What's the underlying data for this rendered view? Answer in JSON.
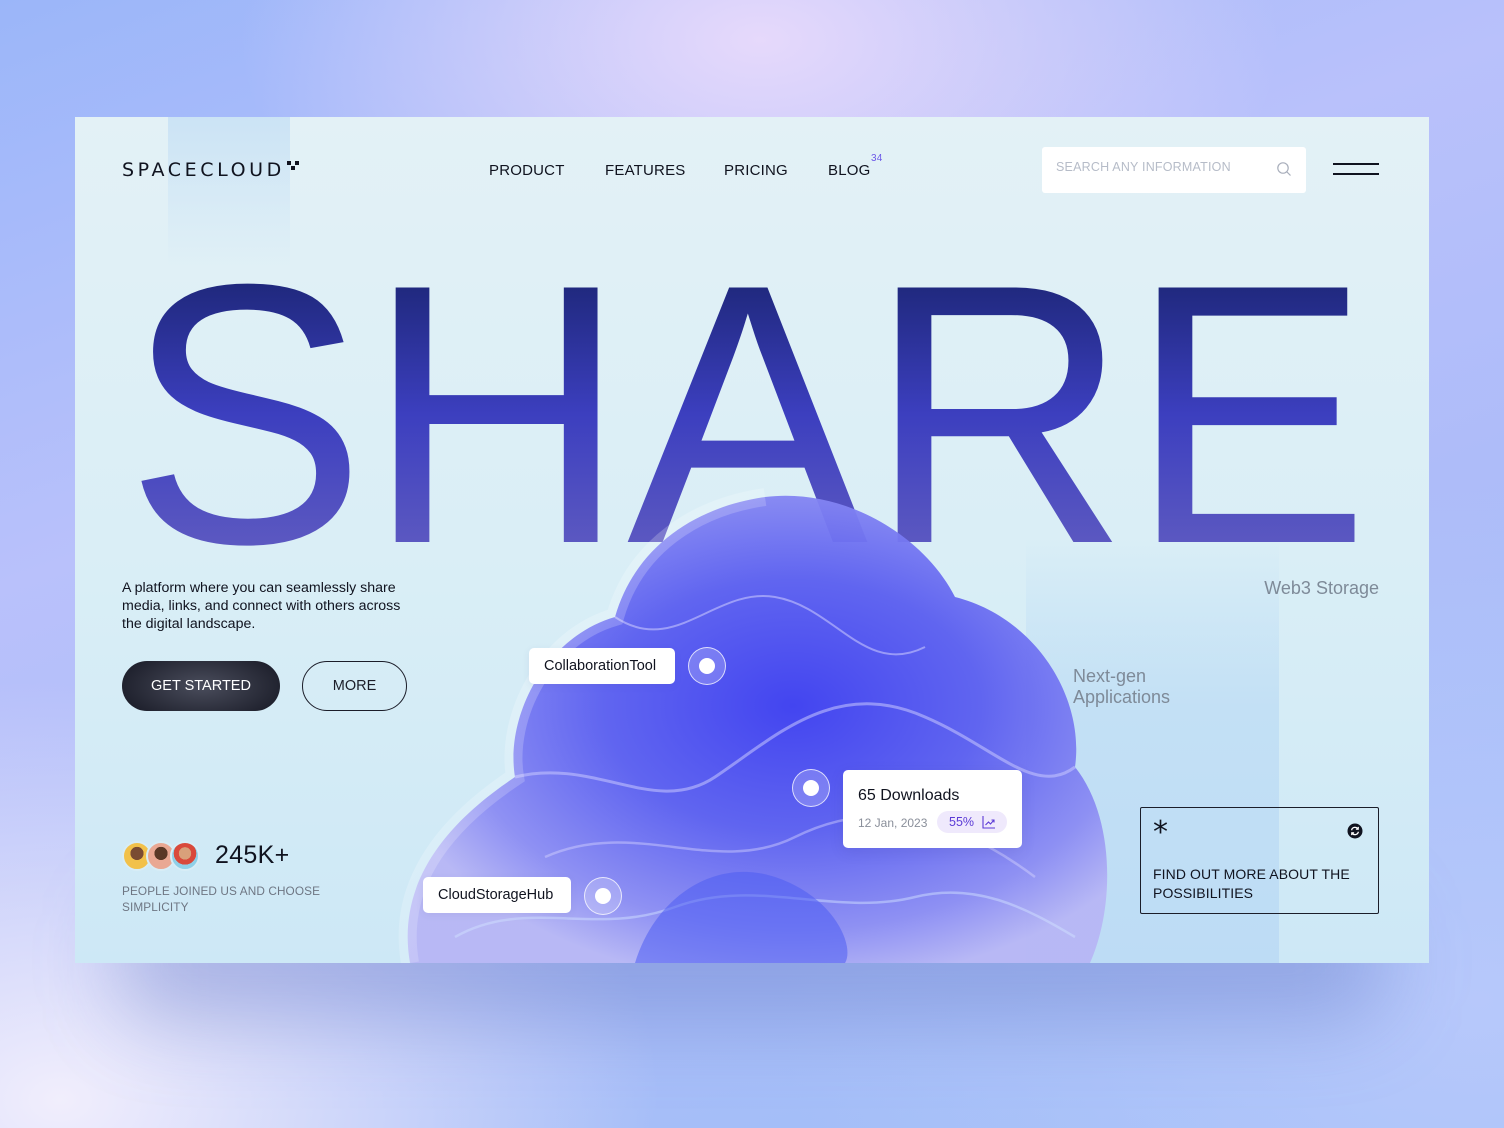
{
  "brand": {
    "name": "SPACECLOUD"
  },
  "nav": {
    "items": [
      {
        "label": "PRODUCT"
      },
      {
        "label": "FEATURES"
      },
      {
        "label": "PRICING"
      },
      {
        "label": "BLOG",
        "badge": "34"
      }
    ]
  },
  "search": {
    "placeholder": "SEARCH ANY INFORMATION",
    "value": "",
    "icon": "search-icon"
  },
  "menu": {
    "icon": "hamburger-menu-icon"
  },
  "hero": {
    "headline": "SHARE",
    "description": "A platform where you can seamlessly share media, links, and connect with others across the digital landscape.",
    "primary_button": "GET STARTED",
    "secondary_button": "MORE"
  },
  "stats": {
    "value": "245K+",
    "caption": "PEOPLE JOINED US AND CHOOSE SIMPLICITY"
  },
  "side_labels": {
    "web3": "Web3 Storage",
    "next_gen": "Next-gen Applications"
  },
  "tags": {
    "collaboration": "CollaborationTool",
    "cloud_storage": "CloudStorageHub"
  },
  "downloads_card": {
    "title": "65 Downloads",
    "date": "12 Jan, 2023",
    "percent": "55%",
    "icon": "trend-up-icon"
  },
  "cta_card": {
    "text": "FIND OUT MORE ABOUT THE POSSIBILITIES",
    "icons": [
      "asterisk-icon",
      "refresh-icon"
    ]
  },
  "colors": {
    "accent": "#5b3ad6",
    "headline_top": "#0f1b57",
    "headline_mid": "#3f3fbf",
    "headline_bottom": "#6a64c0",
    "dark_button": "#1b1d29"
  }
}
